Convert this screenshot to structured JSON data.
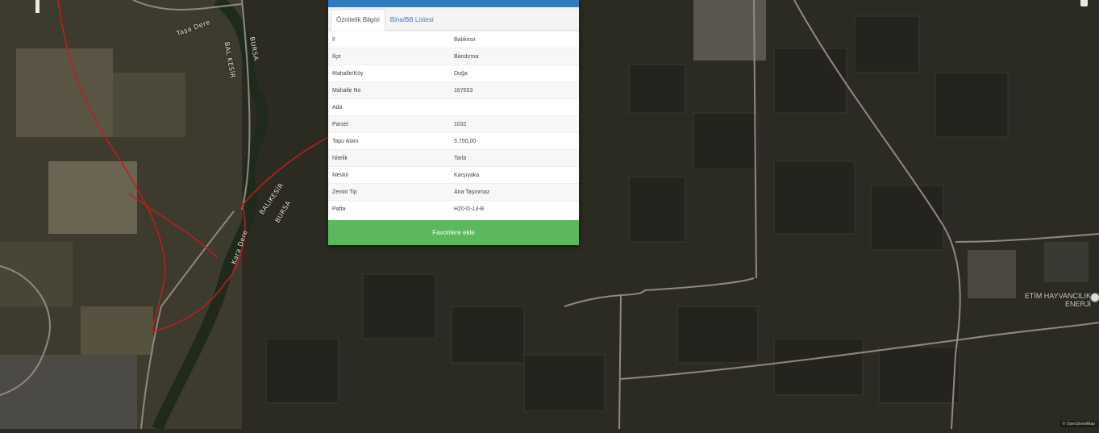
{
  "map": {
    "road_labels": [
      "Taşa Dere",
      "BAL KESİR",
      "BURSA",
      "BALIKESİR",
      "Kara Dere",
      "BURSA"
    ],
    "poi": {
      "line1": "ETİM HAYVANCILIK",
      "line2": "ENERJİ"
    },
    "attribution": "© OpenStreetMap"
  },
  "popup": {
    "tabs": [
      {
        "label": "Öznitelik Bilgisi",
        "active": true
      },
      {
        "label": "Bina/BB Listesi",
        "active": false
      }
    ],
    "rows": [
      {
        "key": "İl",
        "value": "Balıkesir"
      },
      {
        "key": "İlçe",
        "value": "Bandırma"
      },
      {
        "key": "Mahalle/Köy",
        "value": "Doğa"
      },
      {
        "key": "Mahalle No",
        "value": "167653"
      },
      {
        "key": "Ada",
        "value": ""
      },
      {
        "key": "Parsel",
        "value": "1032"
      },
      {
        "key": "Tapu Alanı",
        "value": "5.700,00"
      },
      {
        "key": "Nitelik",
        "value": "Tarla"
      },
      {
        "key": "Mevkii",
        "value": "Karşıyaka"
      },
      {
        "key": "Zemin Tip",
        "value": "Ana Taşınmaz"
      },
      {
        "key": "Pafta",
        "value": "H20-D-13-B"
      }
    ],
    "favorite_button": "Favorilere ekle"
  },
  "colors": {
    "header": "#2f7bc0",
    "button": "#5cb85c",
    "parcel_line": "#c21d1d"
  }
}
